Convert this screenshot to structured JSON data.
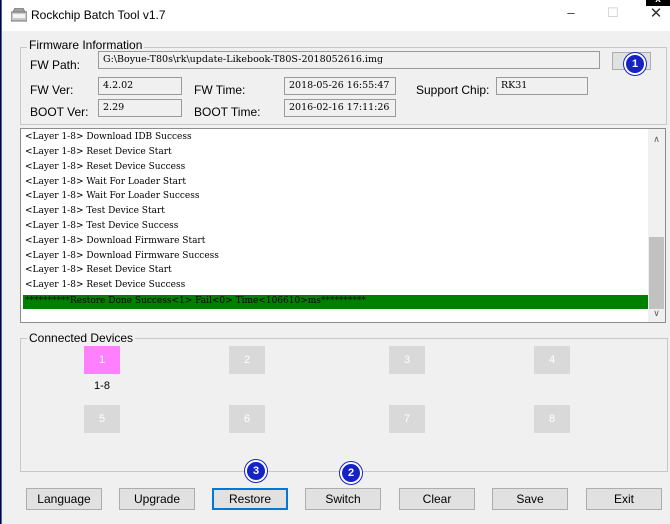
{
  "window": {
    "title": "Rockchip Batch Tool v1.7",
    "minimize": "–",
    "maximize": "☐",
    "close": "✕",
    "close_badge": "x"
  },
  "firmware": {
    "group_label": "Firmware Information",
    "fw_path_label": "FW Path:",
    "fw_path": "G:\\Boyue-T80s\\rk\\update-Likebook-T80S-2018052616.img",
    "fw_ver_label": "FW Ver:",
    "fw_ver": "4.2.02",
    "fw_time_label": "FW Time:",
    "fw_time": "2018-05-26 16:55:47",
    "support_chip_label": "Support Chip:",
    "support_chip": "RK31",
    "boot_ver_label": "BOOT Ver:",
    "boot_ver": "2.29",
    "boot_time_label": "BOOT Time:",
    "boot_time": "2016-02-16 17:11:26"
  },
  "log": {
    "lines": [
      "<Layer 1-8> Download IDB Success",
      "<Layer 1-8> Reset Device Start",
      "<Layer 1-8> Reset Device Success",
      "<Layer 1-8> Wait For Loader Start",
      "<Layer 1-8> Wait For Loader Success",
      "<Layer 1-8> Test Device Start",
      "<Layer 1-8> Test Device Success",
      "<Layer 1-8> Download Firmware Start",
      "<Layer 1-8> Download Firmware Success",
      "<Layer 1-8> Reset Device Start",
      "<Layer 1-8> Reset Device Success"
    ],
    "final": "**********Restore Done Success<1> Fail<0> Time<106610>ms**********",
    "scroll_up": "∧",
    "scroll_down": "∨"
  },
  "devices": {
    "group_label": "Connected Devices",
    "slots": [
      "1",
      "2",
      "3",
      "4",
      "5",
      "6",
      "7",
      "8"
    ],
    "slot1_sub": "1-8"
  },
  "buttons": {
    "language": "Language",
    "upgrade": "Upgrade",
    "restore": "Restore",
    "switch": "Switch",
    "clear": "Clear",
    "save": "Save",
    "exit": "Exit"
  },
  "annotations": {
    "b1": "1",
    "b2": "2",
    "b3": "3"
  },
  "colors": {
    "success_bar": "#008000",
    "active_device": "#ff80ff",
    "badge": "#1522c6"
  }
}
